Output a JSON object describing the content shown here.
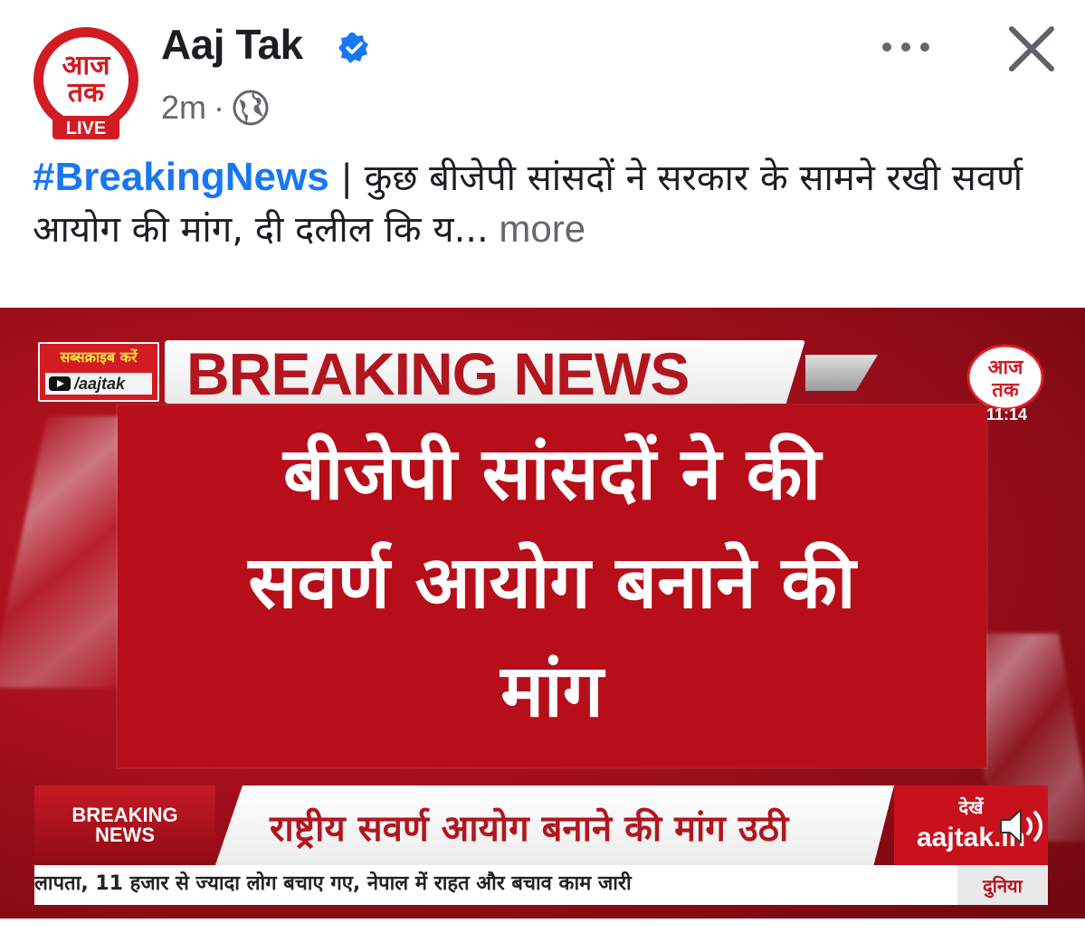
{
  "post": {
    "author": "Aaj Tak",
    "time": "2m",
    "separator": "·",
    "avatar_logo_text": "आज तक",
    "avatar_badge": "LIVE"
  },
  "caption": {
    "hashtag": "#BreakingNews",
    "text": " | कुछ बीजेपी सांसदों ने सरकार के सामने रखी सवर्ण आयोग की मांग, दी दलील कि य...",
    "more": " more"
  },
  "video": {
    "subscribe_label": "सब्सक्राइब करें",
    "channel_handle": "/aajtak",
    "header": "BREAKING NEWS",
    "logo_text": "आज तक",
    "time": "11:14",
    "headline_line1": "बीजेपी सांसदों ने की",
    "headline_line2": "सवर्ण आयोग बनाने की",
    "headline_line3": "मांग",
    "ticker_badge_line1": "BREAKING",
    "ticker_badge_line2": "NEWS",
    "ticker_headline": "राष्ट्रीय सवर्ण आयोग बनाने की मांग उठी",
    "ticker_see": "देखें",
    "ticker_site": "aajtak.in",
    "scroll_text": "लापता, 11 हजार से ज्यादा लोग बचाए गए, नेपाल में राहत और बचाव काम जारी",
    "scroll_category": "दुनिया"
  },
  "colors": {
    "brand_red": "#d31b23",
    "facebook_blue": "#1877f2",
    "text_dark": "#1c1e21",
    "text_gray": "#65676b"
  },
  "icons": [
    "aajtak-logo-icon",
    "verified-badge-icon",
    "globe-icon",
    "more-options-icon",
    "close-icon",
    "youtube-icon",
    "volume-icon"
  ]
}
